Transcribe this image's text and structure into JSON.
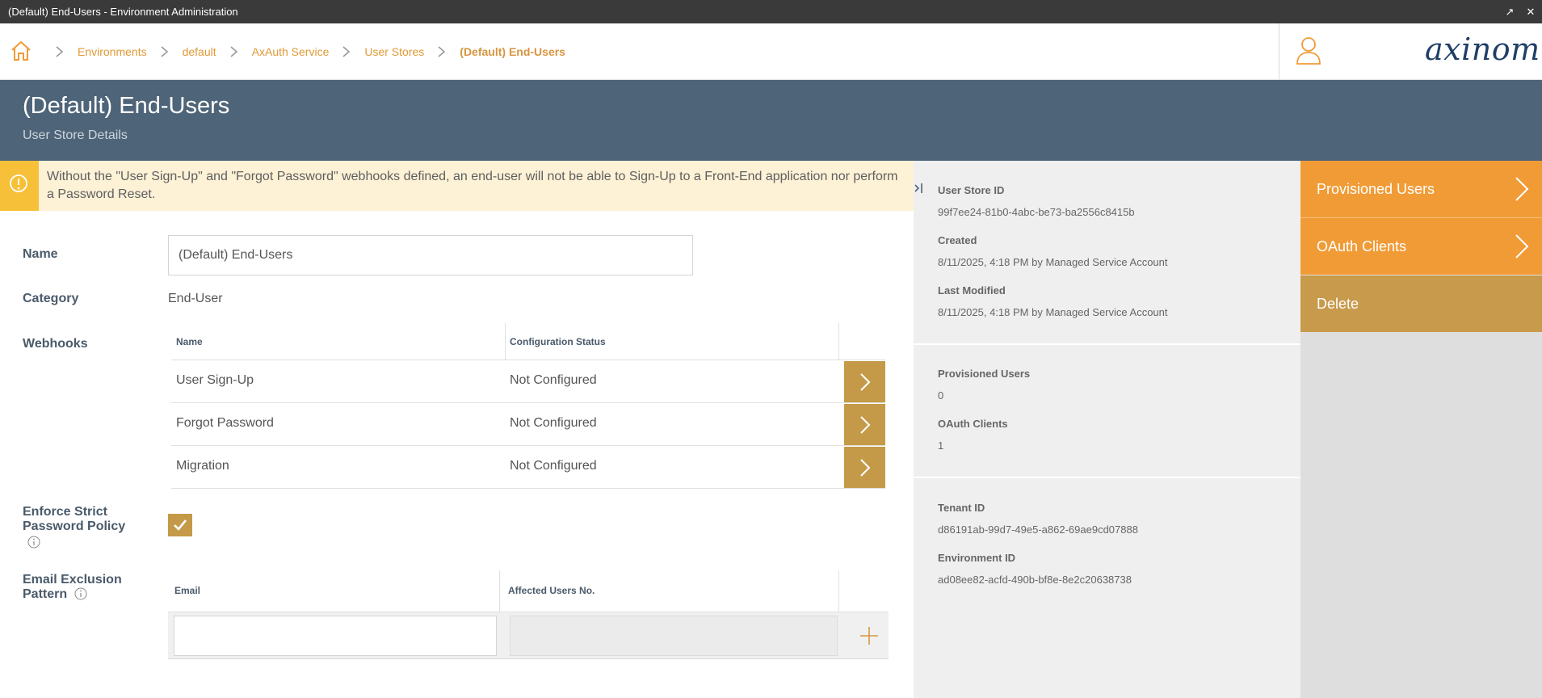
{
  "window": {
    "title": "(Default) End-Users - Environment Administration",
    "btn_popout": "↗",
    "btn_close": "✕"
  },
  "breadcrumb": {
    "items": [
      "Environments",
      "default",
      "AxAuth Service",
      "User Stores"
    ],
    "current": "(Default) End-Users"
  },
  "logo_text": "axinom!",
  "header": {
    "title": "(Default) End-Users",
    "subtitle": "User Store Details"
  },
  "warning": {
    "text": "Without the \"User Sign-Up\" and \"Forgot Password\" webhooks defined, an end-user will not be able to Sign-Up to a Front-End application nor perform a Password Reset."
  },
  "form": {
    "name_label": "Name",
    "name_value": "(Default) End-Users",
    "category_label": "Category",
    "category_value": "End-User",
    "webhooks_label": "Webhooks",
    "webhooks_columns": [
      "Name",
      "Configuration Status"
    ],
    "webhooks_rows": [
      {
        "name": "User Sign-Up",
        "status": "Not Configured"
      },
      {
        "name": "Forgot Password",
        "status": "Not Configured"
      },
      {
        "name": "Migration",
        "status": "Not Configured"
      }
    ],
    "strict_label_line1": "Enforce Strict",
    "strict_label_line2": "Password Policy",
    "strict_checked": true,
    "email_label_line1": "Email Exclusion",
    "email_label_line2": "Pattern",
    "email_columns": [
      "Email",
      "Affected Users No."
    ],
    "email_value": "",
    "affected_value": ""
  },
  "details": {
    "user_store_id_label": "User Store ID",
    "user_store_id": "99f7ee24-81b0-4abc-be73-ba2556c8415b",
    "created_label": "Created",
    "created": "8/11/2025, 4:18 PM by Managed Service Account",
    "last_modified_label": "Last Modified",
    "last_modified": "8/11/2025, 4:18 PM by Managed Service Account",
    "provisioned_users_label": "Provisioned Users",
    "provisioned_users": "0",
    "oauth_clients_label": "OAuth Clients",
    "oauth_clients": "1",
    "tenant_id_label": "Tenant ID",
    "tenant_id": "d86191ab-99d7-49e5-a862-69ae9cd07888",
    "environment_id_label": "Environment ID",
    "environment_id": "ad08ee82-acfd-490b-bf8e-8e2c20638738"
  },
  "actions": {
    "provisioned_users": "Provisioned Users",
    "oauth_clients": "OAuth Clients",
    "delete": "Delete"
  },
  "colors": {
    "accent_orange": "#f19b36",
    "accent_gold": "#c49a48",
    "header_bg": "#4e6478",
    "warning_bg": "#fdf1d6",
    "warning_icon": "#f6c038"
  },
  "icons": [
    "home-icon",
    "chevron-right-icon",
    "user-icon",
    "warning-icon",
    "info-icon",
    "checkmark-icon",
    "plus-icon",
    "collapse-panel-icon"
  ]
}
